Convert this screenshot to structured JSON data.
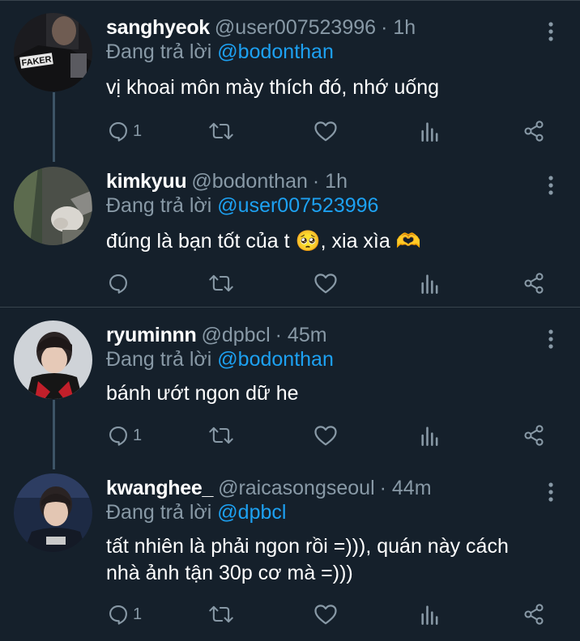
{
  "replying_prefix": "Đang trả lời",
  "colors": {
    "background": "#15202b",
    "mention": "#1da1f2",
    "muted": "#8899a6",
    "divider": "#38444d"
  },
  "tweets": [
    {
      "name": "sanghyeok",
      "handle": "@user007523996",
      "time": "· 1h",
      "reply_to": "@bodonthan",
      "text": "vị khoai môn mày thích đó, nhớ uống",
      "reply_count": "1",
      "avatar_text": "FAKER"
    },
    {
      "name": "kimkyuu",
      "handle": "@bodonthan",
      "time": "· 1h",
      "reply_to": "@user007523996",
      "text": "đúng là bạn tốt của t 🥺, xia xìa 🫶",
      "reply_count": ""
    },
    {
      "name": "ryuminnn",
      "handle": "@dpbcl",
      "time": "· 45m",
      "reply_to": "@bodonthan",
      "text": "bánh ướt ngon dữ he",
      "reply_count": "1"
    },
    {
      "name": "kwanghee_",
      "handle": "@raicasongseoul",
      "time": "· 44m",
      "reply_to": "@dpbcl",
      "text_line1": "tất nhiên là phải ngon rồi =))), quán này cách",
      "text_line2": "nhà ảnh tận 30p cơ mà =)))",
      "reply_count": "1"
    }
  ]
}
